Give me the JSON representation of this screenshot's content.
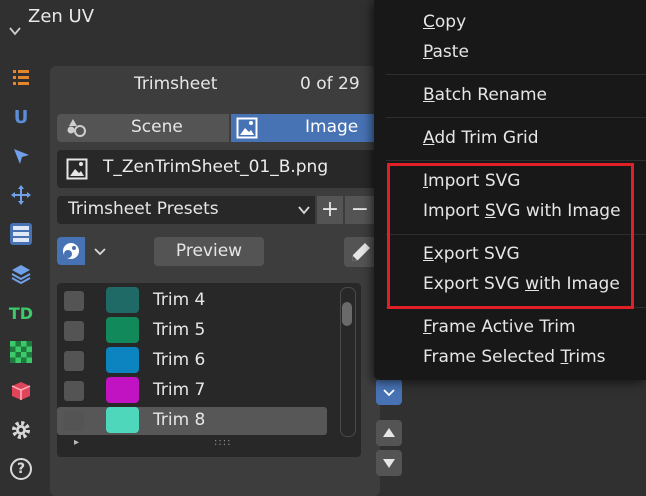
{
  "panel": {
    "title": "Zen UV"
  },
  "sidebar": {
    "icons": [
      "list-icon",
      "u-logo-icon",
      "cursor-icon",
      "move-icon",
      "trimsheet-icon",
      "layers-icon",
      "td-icon",
      "checker-icon",
      "package-icon",
      "gear-icon",
      "help-icon"
    ],
    "td_label": "TD",
    "help_label": "?",
    "u_label": "U"
  },
  "trimsheet": {
    "label": "Trimsheet",
    "count": "0 of 29",
    "tabs": [
      "Scene",
      "Image"
    ],
    "active_tab": "Image",
    "file_name": "T_ZenTrimSheet_01_B.png",
    "presets_label": "Trimsheet Presets",
    "plus": "+",
    "minus": "−",
    "preview_label": "Preview",
    "list_grip": "::::",
    "play": "▸",
    "trims": [
      {
        "name": "Trim 4",
        "color": "#1f6a66"
      },
      {
        "name": "Trim 5",
        "color": "#11895b"
      },
      {
        "name": "Trim 6",
        "color": "#0b84c0"
      },
      {
        "name": "Trim 7",
        "color": "#c213c3"
      },
      {
        "name": "Trim 8",
        "color": "#4fd7bc",
        "selected": true
      }
    ]
  },
  "context_menu": {
    "copy": {
      "pre": "",
      "u": "C",
      "post": "opy"
    },
    "paste": {
      "pre": "",
      "u": "P",
      "post": "aste"
    },
    "batch_rename": {
      "pre": "",
      "u": "B",
      "post": "atch Rename"
    },
    "add_trim_grid": {
      "pre": "",
      "u": "A",
      "post": "dd Trim Grid"
    },
    "import_svg": {
      "pre": "",
      "u": "I",
      "post": "mport SVG"
    },
    "import_svg_image": {
      "pre": "Import ",
      "u": "S",
      "post": "VG with Image"
    },
    "export_svg": {
      "pre": "",
      "u": "E",
      "post": "xport SVG"
    },
    "export_svg_image": {
      "pre": "Export SVG ",
      "u": "w",
      "post": "ith Image"
    },
    "frame_active": {
      "pre": "",
      "u": "F",
      "post": "rame Active Trim"
    },
    "frame_selected": {
      "pre": "Frame Selected ",
      "u": "T",
      "post": "rims"
    }
  },
  "colors": {
    "accent": "#4772b3",
    "highlight": "#e11f26",
    "menu_bg": "#181818",
    "panel_bg": "#3d3d3d"
  }
}
